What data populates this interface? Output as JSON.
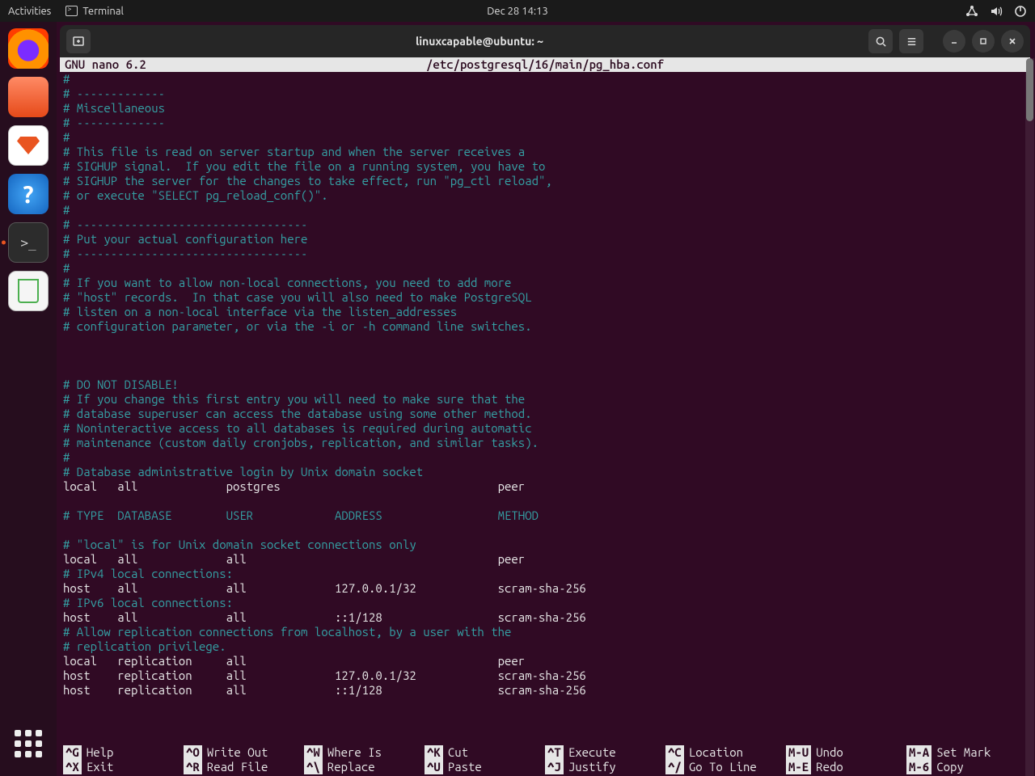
{
  "topbar": {
    "activities": "Activities",
    "app": "Terminal",
    "clock": "Dec 28  14:13"
  },
  "dock": {
    "items": [
      "firefox",
      "files",
      "software",
      "help",
      "terminal",
      "trash"
    ]
  },
  "window": {
    "new_tab_tooltip": "New Tab",
    "title": "linuxcapable@ubuntu: ~"
  },
  "nano": {
    "app": "  GNU nano 6.2",
    "file": "/etc/postgresql/16/main/pg_hba.conf",
    "lines": [
      {
        "c": "cm",
        "t": "#"
      },
      {
        "c": "cm",
        "t": "# -------------"
      },
      {
        "c": "cm",
        "t": "# Miscellaneous"
      },
      {
        "c": "cm",
        "t": "# -------------"
      },
      {
        "c": "cm",
        "t": "#"
      },
      {
        "c": "cm",
        "t": "# This file is read on server startup and when the server receives a"
      },
      {
        "c": "cm",
        "t": "# SIGHUP signal.  If you edit the file on a running system, you have to"
      },
      {
        "c": "cm",
        "t": "# SIGHUP the server for the changes to take effect, run \"pg_ctl reload\","
      },
      {
        "c": "cm",
        "t": "# or execute \"SELECT pg_reload_conf()\"."
      },
      {
        "c": "cm",
        "t": "#"
      },
      {
        "c": "cm",
        "t": "# ----------------------------------"
      },
      {
        "c": "cm",
        "t": "# Put your actual configuration here"
      },
      {
        "c": "cm",
        "t": "# ----------------------------------"
      },
      {
        "c": "cm",
        "t": "#"
      },
      {
        "c": "cm",
        "t": "# If you want to allow non-local connections, you need to add more"
      },
      {
        "c": "cm",
        "t": "# \"host\" records.  In that case you will also need to make PostgreSQL"
      },
      {
        "c": "cm",
        "t": "# listen on a non-local interface via the listen_addresses"
      },
      {
        "c": "cm",
        "t": "# configuration parameter, or via the -i or -h command line switches."
      },
      {
        "c": "tx",
        "t": ""
      },
      {
        "c": "tx",
        "t": ""
      },
      {
        "c": "tx",
        "t": ""
      },
      {
        "c": "cm",
        "t": "# DO NOT DISABLE!"
      },
      {
        "c": "cm",
        "t": "# If you change this first entry you will need to make sure that the"
      },
      {
        "c": "cm",
        "t": "# database superuser can access the database using some other method."
      },
      {
        "c": "cm",
        "t": "# Noninteractive access to all databases is required during automatic"
      },
      {
        "c": "cm",
        "t": "# maintenance (custom daily cronjobs, replication, and similar tasks)."
      },
      {
        "c": "cm",
        "t": "#"
      },
      {
        "c": "cm",
        "t": "# Database administrative login by Unix domain socket"
      },
      {
        "c": "tx",
        "t": "local   all             postgres                                peer"
      },
      {
        "c": "tx",
        "t": ""
      },
      {
        "c": "cm",
        "t": "# TYPE  DATABASE        USER            ADDRESS                 METHOD"
      },
      {
        "c": "tx",
        "t": ""
      },
      {
        "c": "cm",
        "t": "# \"local\" is for Unix domain socket connections only"
      },
      {
        "c": "tx",
        "t": "local   all             all                                     peer"
      },
      {
        "c": "cm",
        "t": "# IPv4 local connections:"
      },
      {
        "c": "tx",
        "t": "host    all             all             127.0.0.1/32            scram-sha-256"
      },
      {
        "c": "cm",
        "t": "# IPv6 local connections:"
      },
      {
        "c": "tx",
        "t": "host    all             all             ::1/128                 scram-sha-256"
      },
      {
        "c": "cm",
        "t": "# Allow replication connections from localhost, by a user with the"
      },
      {
        "c": "cm",
        "t": "# replication privilege."
      },
      {
        "c": "tx",
        "t": "local   replication     all                                     peer"
      },
      {
        "c": "tx",
        "t": "host    replication     all             127.0.0.1/32            scram-sha-256"
      },
      {
        "c": "tx",
        "t": "host    replication     all             ::1/128                 scram-sha-256"
      }
    ],
    "shortcuts_row1": [
      {
        "k": "^G",
        "l": "Help"
      },
      {
        "k": "^O",
        "l": "Write Out"
      },
      {
        "k": "^W",
        "l": "Where Is"
      },
      {
        "k": "^K",
        "l": "Cut"
      },
      {
        "k": "^T",
        "l": "Execute"
      },
      {
        "k": "^C",
        "l": "Location"
      },
      {
        "k": "M-U",
        "l": "Undo"
      },
      {
        "k": "M-A",
        "l": "Set Mark"
      }
    ],
    "shortcuts_row2": [
      {
        "k": "^X",
        "l": "Exit"
      },
      {
        "k": "^R",
        "l": "Read File"
      },
      {
        "k": "^\\",
        "l": "Replace"
      },
      {
        "k": "^U",
        "l": "Paste"
      },
      {
        "k": "^J",
        "l": "Justify"
      },
      {
        "k": "^/",
        "l": "Go To Line"
      },
      {
        "k": "M-E",
        "l": "Redo"
      },
      {
        "k": "M-6",
        "l": "Copy"
      }
    ]
  }
}
